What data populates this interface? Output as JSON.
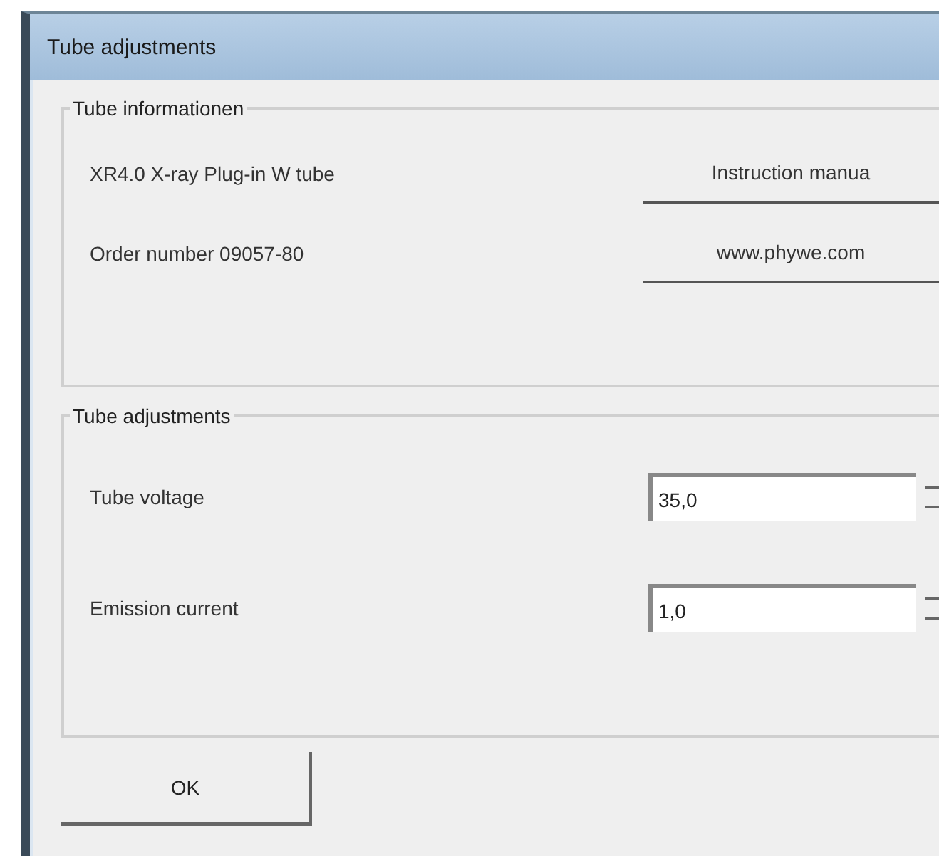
{
  "window": {
    "title": "Tube adjustments"
  },
  "info_group": {
    "title": "Tube informationen",
    "rows": [
      {
        "label": "XR4.0 X-ray Plug-in W tube",
        "button": "Instruction manua"
      },
      {
        "label": "Order number 09057-80",
        "button": "www.phywe.com"
      }
    ]
  },
  "adjust_group": {
    "title": "Tube adjustments",
    "fields": [
      {
        "label": "Tube voltage",
        "value": "35,0"
      },
      {
        "label": "Emission current",
        "value": "1,0"
      }
    ]
  },
  "buttons": [
    "OK"
  ]
}
